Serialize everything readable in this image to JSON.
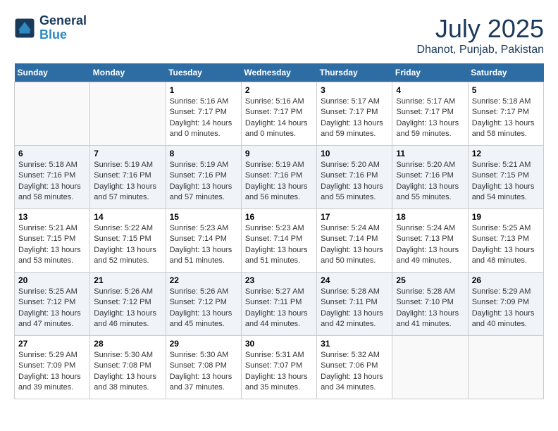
{
  "header": {
    "logo_line1": "General",
    "logo_line2": "Blue",
    "month": "July 2025",
    "location": "Dhanot, Punjab, Pakistan"
  },
  "weekdays": [
    "Sunday",
    "Monday",
    "Tuesday",
    "Wednesday",
    "Thursday",
    "Friday",
    "Saturday"
  ],
  "weeks": [
    [
      {
        "day": "",
        "info": ""
      },
      {
        "day": "",
        "info": ""
      },
      {
        "day": "1",
        "info": "Sunrise: 5:16 AM\nSunset: 7:17 PM\nDaylight: 14 hours\nand 0 minutes."
      },
      {
        "day": "2",
        "info": "Sunrise: 5:16 AM\nSunset: 7:17 PM\nDaylight: 14 hours\nand 0 minutes."
      },
      {
        "day": "3",
        "info": "Sunrise: 5:17 AM\nSunset: 7:17 PM\nDaylight: 13 hours\nand 59 minutes."
      },
      {
        "day": "4",
        "info": "Sunrise: 5:17 AM\nSunset: 7:17 PM\nDaylight: 13 hours\nand 59 minutes."
      },
      {
        "day": "5",
        "info": "Sunrise: 5:18 AM\nSunset: 7:17 PM\nDaylight: 13 hours\nand 58 minutes."
      }
    ],
    [
      {
        "day": "6",
        "info": "Sunrise: 5:18 AM\nSunset: 7:16 PM\nDaylight: 13 hours\nand 58 minutes."
      },
      {
        "day": "7",
        "info": "Sunrise: 5:19 AM\nSunset: 7:16 PM\nDaylight: 13 hours\nand 57 minutes."
      },
      {
        "day": "8",
        "info": "Sunrise: 5:19 AM\nSunset: 7:16 PM\nDaylight: 13 hours\nand 57 minutes."
      },
      {
        "day": "9",
        "info": "Sunrise: 5:19 AM\nSunset: 7:16 PM\nDaylight: 13 hours\nand 56 minutes."
      },
      {
        "day": "10",
        "info": "Sunrise: 5:20 AM\nSunset: 7:16 PM\nDaylight: 13 hours\nand 55 minutes."
      },
      {
        "day": "11",
        "info": "Sunrise: 5:20 AM\nSunset: 7:16 PM\nDaylight: 13 hours\nand 55 minutes."
      },
      {
        "day": "12",
        "info": "Sunrise: 5:21 AM\nSunset: 7:15 PM\nDaylight: 13 hours\nand 54 minutes."
      }
    ],
    [
      {
        "day": "13",
        "info": "Sunrise: 5:21 AM\nSunset: 7:15 PM\nDaylight: 13 hours\nand 53 minutes."
      },
      {
        "day": "14",
        "info": "Sunrise: 5:22 AM\nSunset: 7:15 PM\nDaylight: 13 hours\nand 52 minutes."
      },
      {
        "day": "15",
        "info": "Sunrise: 5:23 AM\nSunset: 7:14 PM\nDaylight: 13 hours\nand 51 minutes."
      },
      {
        "day": "16",
        "info": "Sunrise: 5:23 AM\nSunset: 7:14 PM\nDaylight: 13 hours\nand 51 minutes."
      },
      {
        "day": "17",
        "info": "Sunrise: 5:24 AM\nSunset: 7:14 PM\nDaylight: 13 hours\nand 50 minutes."
      },
      {
        "day": "18",
        "info": "Sunrise: 5:24 AM\nSunset: 7:13 PM\nDaylight: 13 hours\nand 49 minutes."
      },
      {
        "day": "19",
        "info": "Sunrise: 5:25 AM\nSunset: 7:13 PM\nDaylight: 13 hours\nand 48 minutes."
      }
    ],
    [
      {
        "day": "20",
        "info": "Sunrise: 5:25 AM\nSunset: 7:12 PM\nDaylight: 13 hours\nand 47 minutes."
      },
      {
        "day": "21",
        "info": "Sunrise: 5:26 AM\nSunset: 7:12 PM\nDaylight: 13 hours\nand 46 minutes."
      },
      {
        "day": "22",
        "info": "Sunrise: 5:26 AM\nSunset: 7:12 PM\nDaylight: 13 hours\nand 45 minutes."
      },
      {
        "day": "23",
        "info": "Sunrise: 5:27 AM\nSunset: 7:11 PM\nDaylight: 13 hours\nand 44 minutes."
      },
      {
        "day": "24",
        "info": "Sunrise: 5:28 AM\nSunset: 7:11 PM\nDaylight: 13 hours\nand 42 minutes."
      },
      {
        "day": "25",
        "info": "Sunrise: 5:28 AM\nSunset: 7:10 PM\nDaylight: 13 hours\nand 41 minutes."
      },
      {
        "day": "26",
        "info": "Sunrise: 5:29 AM\nSunset: 7:09 PM\nDaylight: 13 hours\nand 40 minutes."
      }
    ],
    [
      {
        "day": "27",
        "info": "Sunrise: 5:29 AM\nSunset: 7:09 PM\nDaylight: 13 hours\nand 39 minutes."
      },
      {
        "day": "28",
        "info": "Sunrise: 5:30 AM\nSunset: 7:08 PM\nDaylight: 13 hours\nand 38 minutes."
      },
      {
        "day": "29",
        "info": "Sunrise: 5:30 AM\nSunset: 7:08 PM\nDaylight: 13 hours\nand 37 minutes."
      },
      {
        "day": "30",
        "info": "Sunrise: 5:31 AM\nSunset: 7:07 PM\nDaylight: 13 hours\nand 35 minutes."
      },
      {
        "day": "31",
        "info": "Sunrise: 5:32 AM\nSunset: 7:06 PM\nDaylight: 13 hours\nand 34 minutes."
      },
      {
        "day": "",
        "info": ""
      },
      {
        "day": "",
        "info": ""
      }
    ]
  ]
}
